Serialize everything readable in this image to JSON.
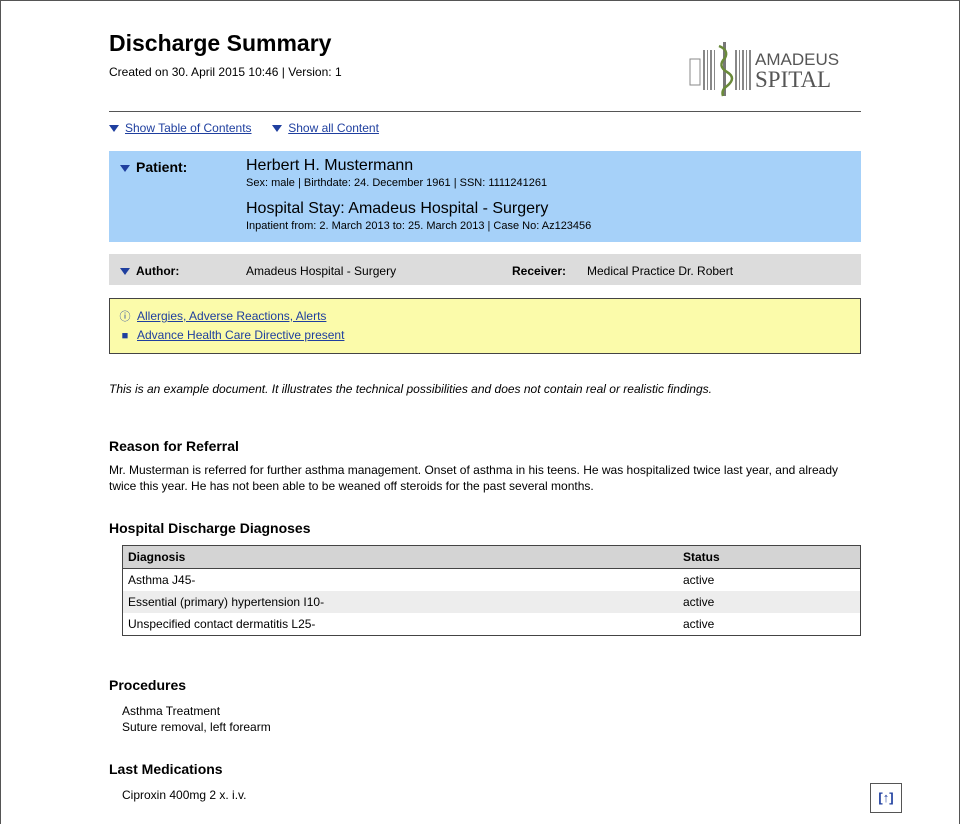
{
  "header": {
    "title": "Discharge Summary",
    "created": "Created on 30. April 2015 10:46 | Version: 1",
    "logo_top": "AMADEUS",
    "logo_bottom": "SPITAL"
  },
  "toc": {
    "show_toc": "Show Table of Contents",
    "show_all": "Show all Content"
  },
  "patient": {
    "label": "Patient:",
    "name": "Herbert H. Mustermann",
    "details": "Sex: male | Birthdate: 24. December 1961 | SSN: 1111241261",
    "stay": "Hospital Stay: Amadeus Hospital - Surgery",
    "stay_details": "Inpatient from: 2. March 2013 to: 25. March 2013 | Case No: Az123456"
  },
  "author": {
    "label": "Author:",
    "value": "Amadeus Hospital - Surgery",
    "receiver_label": "Receiver:",
    "receiver_value": "Medical Practice Dr. Robert"
  },
  "alerts": {
    "allergies": "Allergies, Adverse Reactions, Alerts",
    "directive": "Advance Health Care Directive present"
  },
  "note": "This is an example document. It illustrates the technical possibilities and does not contain real or realistic findings.",
  "sections": {
    "referral_title": "Reason for Referral",
    "referral_text": "Mr. Musterman is referred for further asthma management. Onset of asthma in his teens. He was hospitalized twice last year, and already twice this year. He has not been able to be weaned off steroids for the past several months.",
    "diagnoses_title": "Hospital Discharge Diagnoses",
    "procedures_title": "Procedures",
    "procedures": [
      "Asthma Treatment",
      "Suture removal, left forearm"
    ],
    "medications_title": "Last Medications",
    "medications": [
      "Ciproxin 400mg 2 x. i.v."
    ]
  },
  "diagnoses": {
    "headers": [
      "Diagnosis",
      "Status"
    ],
    "rows": [
      [
        "Asthma J45-",
        "active"
      ],
      [
        "Essential (primary) hypertension I10-",
        "active"
      ],
      [
        "Unspecified contact dermatitis L25-",
        "active"
      ]
    ]
  },
  "top_button": "[↑]",
  "colors": {
    "patient_bg": "#a6d1f9",
    "author_bg": "#dcdcdc",
    "alerts_bg": "#fbfbaa",
    "link": "#1f3f9f"
  }
}
